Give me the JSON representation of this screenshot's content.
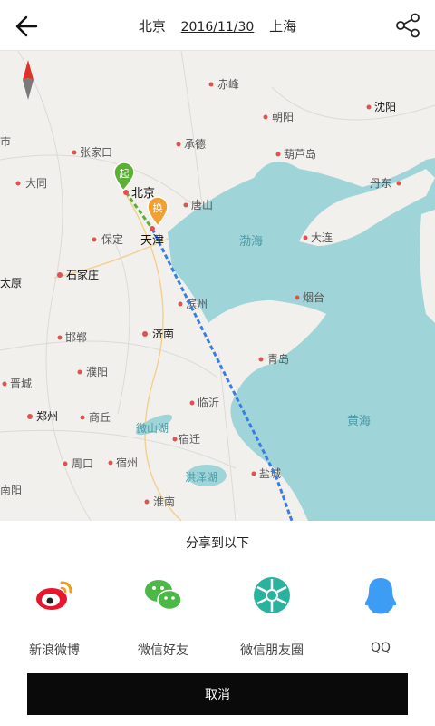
{
  "header": {
    "from_city": "北京",
    "date": "2016/11/30",
    "to_city": "上海",
    "back_icon": "back-arrow-icon",
    "share_icon": "share-icon"
  },
  "map": {
    "compass_icon": "north-compass-icon",
    "markers": {
      "start": "起",
      "transfer": "换"
    },
    "cities": {
      "shi": "市",
      "zhangjiakou": "张家口",
      "chengde": "承德",
      "chifeng": "赤峰",
      "chaoyang": "朝阳",
      "shenyang": "沈阳",
      "datong": "大同",
      "beijing": "北京",
      "huludao": "葫芦岛",
      "dandong": "丹东",
      "tangshan": "唐山",
      "baoding": "保定",
      "tianjin": "天津",
      "dalian": "大连",
      "taiyuan": "太原",
      "shijiazhuang": "石家庄",
      "binzhou": "滨州",
      "yantai": "烟台",
      "handan": "邯郸",
      "jinan": "济南",
      "qingdao": "青岛",
      "jincheng": "晋城",
      "puyang": "濮阳",
      "linyi": "临沂",
      "zhengzhou": "郑州",
      "shangqiu": "商丘",
      "suqian": "宿迁",
      "zhoukou": "周口",
      "suzhou": "宿州",
      "yancheng": "盐城",
      "nanyang": "南阳",
      "huainan": "淮南"
    },
    "water": {
      "bohai": "渤海",
      "huanghai": "黄海",
      "weishan_lake": "微山湖",
      "hongze_lake": "洪泽湖"
    }
  },
  "share_panel": {
    "title": "分享到以下",
    "options": [
      {
        "label": "新浪微博",
        "icon": "weibo-icon",
        "color": "#e6162d"
      },
      {
        "label": "微信好友",
        "icon": "wechat-icon",
        "color": "#4cb848"
      },
      {
        "label": "微信朋友圈",
        "icon": "moments-icon",
        "color": "#2bb29e"
      },
      {
        "label": "QQ",
        "icon": "qq-icon",
        "color": "#3d9df4"
      }
    ],
    "cancel_label": "取消"
  },
  "colors": {
    "sea": "#9fd4d8",
    "land": "#f1f0ed",
    "route": "#3a7ee0",
    "start_marker": "#5bb035",
    "transfer_marker": "#f2a033"
  }
}
